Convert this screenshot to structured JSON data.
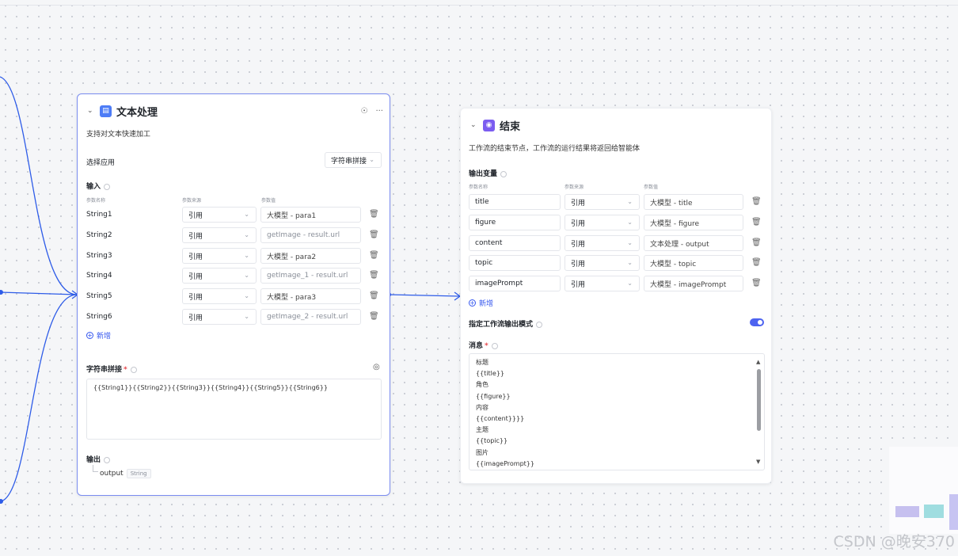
{
  "text_node": {
    "title": "文本处理",
    "description": "支持对文本快速加工",
    "select_app_label": "选择应用",
    "app_value": "字符串拼接",
    "input_label": "输入",
    "col_name": "参数名称",
    "col_source": "参数来源",
    "col_value": "参数值",
    "params": [
      {
        "name": "String1",
        "source": "引用",
        "value": "大模型 - para1"
      },
      {
        "name": "String2",
        "source": "引用",
        "value": "getImage - result.url"
      },
      {
        "name": "String3",
        "source": "引用",
        "value": "大模型 - para2"
      },
      {
        "name": "String4",
        "source": "引用",
        "value": "getImage_1 - result.url"
      },
      {
        "name": "String5",
        "source": "引用",
        "value": "大模型 - para3"
      },
      {
        "name": "String6",
        "source": "引用",
        "value": "getImage_2 - result.url"
      }
    ],
    "add_label": "新增",
    "concat_label": "字符串拼接",
    "concat_value": "{{String1}}{{String2}}{{String3}}{{String4}}{{String5}}{{String6}}",
    "output_label": "输出",
    "output_name": "output",
    "output_type": "String"
  },
  "end_node": {
    "title": "结束",
    "description": "工作流的结束节点，工作流的运行结果将返回给智能体",
    "output_vars_label": "输出变量",
    "col_name": "参数名称",
    "col_source": "参数来源",
    "col_value": "参数值",
    "params": [
      {
        "name": "title",
        "source": "引用",
        "value": "大模型 - title"
      },
      {
        "name": "figure",
        "source": "引用",
        "value": "大模型 - figure"
      },
      {
        "name": "content",
        "source": "引用",
        "value": "文本处理 - output"
      },
      {
        "name": "topic",
        "source": "引用",
        "value": "大模型 - topic"
      },
      {
        "name": "imagePrompt",
        "source": "引用",
        "value": "大模型 - imagePrompt"
      }
    ],
    "add_label": "新增",
    "mode_label": "指定工作流输出模式",
    "message_label": "消息",
    "message_lines": [
      "标题",
      "{{title}}",
      "角色",
      "{{figure}}",
      "内容",
      "{{content}}}}",
      "主题",
      "{{topic}}",
      "图片",
      "{{imagePrompt}}"
    ]
  },
  "watermark": "CSDN @晚安370",
  "colors": {
    "accent": "#2e5ce8",
    "text_icon": "#4d7cf6",
    "end_icon": "#7b5cf0"
  }
}
